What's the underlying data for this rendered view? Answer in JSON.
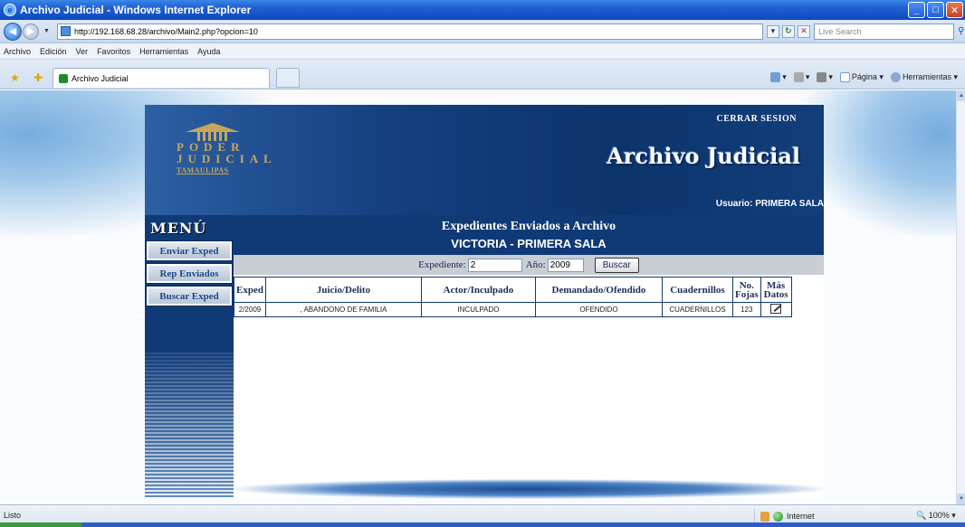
{
  "window": {
    "title": "Archivo Judicial - Windows Internet Explorer"
  },
  "address_bar": {
    "url": "http://192.168.68.28/archivo/Main2.php?opcion=10",
    "search_placeholder": "Live Search"
  },
  "menu_bar": {
    "items": [
      "Archivo",
      "Edición",
      "Ver",
      "Favoritos",
      "Herramientas",
      "Ayuda"
    ]
  },
  "tabs": [
    {
      "label": "Archivo Judicial"
    }
  ],
  "command_bar": {
    "page_label": "Página",
    "tools_label": "Herramientas"
  },
  "page": {
    "logo": {
      "line1": "PODER",
      "line2": "JUDICIAL",
      "line3": "TAMAULIPAS"
    },
    "logout_label": "CERRAR SESION",
    "app_title": "Archivo Judicial",
    "user_label": "Usuario:",
    "user_name": "PRIMERA SALA",
    "menu_title": "MENÚ",
    "menu_items": [
      "Enviar Exped",
      "Rep Enviados",
      "Buscar Exped"
    ],
    "content_title": "Expedientes Enviados a Archivo",
    "content_subtitle": "VICTORIA - PRIMERA SALA",
    "search": {
      "expediente_label": "Expediente:",
      "expediente_value": "2",
      "anio_label": "Año:",
      "anio_value": "2009",
      "button_label": "Buscar"
    },
    "table": {
      "headers": [
        "Exped",
        "Juicio/Delito",
        "Actor/Inculpado",
        "Demandado/Ofendido",
        "Cuadernillos",
        "No. Fojas",
        "Más Datos"
      ],
      "rows": [
        [
          "2/2009",
          ", ABANDONO DE FAMILIA",
          "INCULPADO",
          "OFENDIDO",
          "CUADERNILLOS",
          "123",
          ""
        ]
      ]
    }
  },
  "status_bar": {
    "status": "Listo",
    "zone": "Internet",
    "zoom": "100%"
  }
}
